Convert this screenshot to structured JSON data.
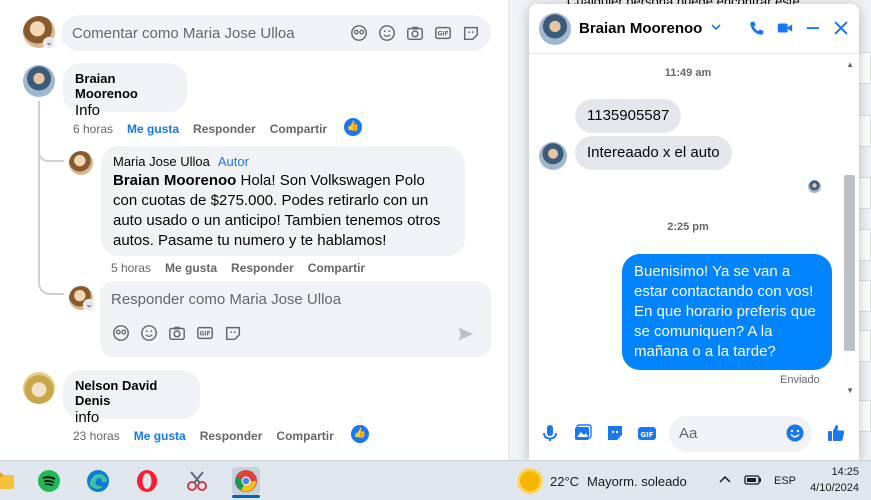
{
  "comment_box": {
    "placeholder": "Comentar como Maria Jose Ulloa"
  },
  "comments": [
    {
      "author": "Braian Moorenoo",
      "text": "Info",
      "time": "6 horas",
      "like": "Me gusta",
      "reply": "Responder",
      "share": "Compartir"
    },
    {
      "author": "Maria Jose Ulloa",
      "author_tag": "Autor",
      "mention": "Braian Moorenoo",
      "text": "Hola! Son Volkswagen Polo con cuotas de $275.000. Podes retirarlo con un auto usado o un anticipo! Tambien tenemos otros autos. Pasame tu numero y te hablamos!",
      "time": "5 horas",
      "like": "Me gusta",
      "reply": "Responder",
      "share": "Compartir"
    },
    {
      "author": "Nelson David Denis",
      "text": "info",
      "time": "23 horas",
      "like": "Me gusta",
      "reply": "Responder",
      "share": "Compartir"
    }
  ],
  "reply_box": {
    "placeholder": "Responder como Maria Jose Ulloa"
  },
  "behind_text": "Cualquier persona puede encontrar este",
  "chat": {
    "contact": "Braian Moorenoo",
    "messages": [
      {
        "type": "timestamp",
        "text": "11:49 am"
      },
      {
        "type": "in",
        "text": "1135905587"
      },
      {
        "type": "in",
        "text": "Intereaado x el auto"
      },
      {
        "type": "timestamp",
        "text": "2:25 pm"
      },
      {
        "type": "out",
        "text": "Buenisimo! Ya se van a estar contactando con vos! En que horario preferis que se comuniquen? A la mañana o a la tarde?"
      }
    ],
    "status": "Enviado",
    "input_placeholder": "Aa"
  },
  "taskbar": {
    "weather": "22°C",
    "weather_desc": "Mayorm. soleado",
    "language": "ESP",
    "time": "14:25",
    "date": "4/10/2024"
  },
  "colors": {
    "accent": "#1877f2",
    "message_out": "#0084ff",
    "bubble": "#f0f2f5"
  }
}
